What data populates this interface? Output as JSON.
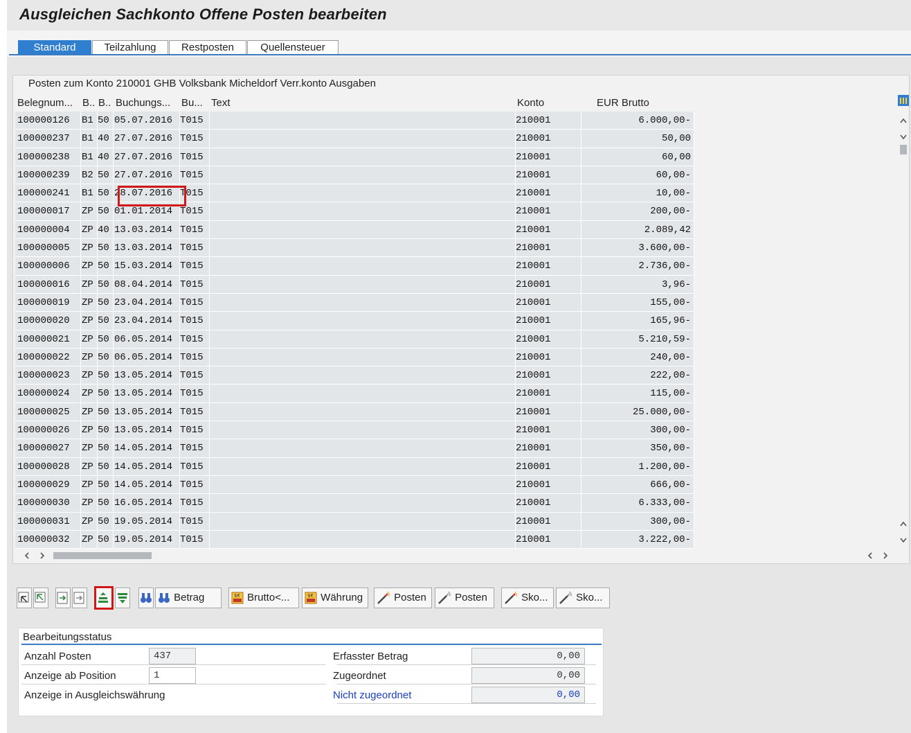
{
  "window": {
    "title": "Ausgleichen Sachkonto Offene Posten bearbeiten"
  },
  "tabs": [
    {
      "label": "Standard",
      "active": true
    },
    {
      "label": "Teilzahlung",
      "active": false
    },
    {
      "label": "Restposten",
      "active": false
    },
    {
      "label": "Quellensteuer",
      "active": false
    }
  ],
  "grid": {
    "title": "Posten zum Konto 210001 GHB Volksbank Micheldorf Verr.konto Ausgaben",
    "columns": [
      "Belegnum...",
      "B..",
      "B..",
      "Buchungs...",
      "Bu...",
      "Text",
      "Konto",
      "EUR Brutto"
    ],
    "rows": [
      [
        "100000126",
        "B1",
        "50",
        "05.07.2016",
        "T015",
        "",
        "210001",
        "6.000,00-"
      ],
      [
        "100000237",
        "B1",
        "40",
        "27.07.2016",
        "T015",
        "",
        "210001",
        "50,00"
      ],
      [
        "100000238",
        "B1",
        "40",
        "27.07.2016",
        "T015",
        "",
        "210001",
        "60,00"
      ],
      [
        "100000239",
        "B2",
        "50",
        "27.07.2016",
        "T015",
        "",
        "210001",
        "60,00-"
      ],
      [
        "100000241",
        "B1",
        "50",
        "28.07.2016",
        "T015",
        "",
        "210001",
        "10,00-"
      ],
      [
        "100000017",
        "ZP",
        "50",
        "01.01.2014",
        "T015",
        "",
        "210001",
        "200,00-"
      ],
      [
        "100000004",
        "ZP",
        "40",
        "13.03.2014",
        "T015",
        "",
        "210001",
        "2.089,42"
      ],
      [
        "100000005",
        "ZP",
        "50",
        "13.03.2014",
        "T015",
        "",
        "210001",
        "3.600,00-"
      ],
      [
        "100000006",
        "ZP",
        "50",
        "15.03.2014",
        "T015",
        "",
        "210001",
        "2.736,00-"
      ],
      [
        "100000016",
        "ZP",
        "50",
        "08.04.2014",
        "T015",
        "",
        "210001",
        "3,96-"
      ],
      [
        "100000019",
        "ZP",
        "50",
        "23.04.2014",
        "T015",
        "",
        "210001",
        "155,00-"
      ],
      [
        "100000020",
        "ZP",
        "50",
        "23.04.2014",
        "T015",
        "",
        "210001",
        "165,96-"
      ],
      [
        "100000021",
        "ZP",
        "50",
        "06.05.2014",
        "T015",
        "",
        "210001",
        "5.210,59-"
      ],
      [
        "100000022",
        "ZP",
        "50",
        "06.05.2014",
        "T015",
        "",
        "210001",
        "240,00-"
      ],
      [
        "100000023",
        "ZP",
        "50",
        "13.05.2014",
        "T015",
        "",
        "210001",
        "222,00-"
      ],
      [
        "100000024",
        "ZP",
        "50",
        "13.05.2014",
        "T015",
        "",
        "210001",
        "115,00-"
      ],
      [
        "100000025",
        "ZP",
        "50",
        "13.05.2014",
        "T015",
        "",
        "210001",
        "25.000,00-"
      ],
      [
        "100000026",
        "ZP",
        "50",
        "13.05.2014",
        "T015",
        "",
        "210001",
        "300,00-"
      ],
      [
        "100000027",
        "ZP",
        "50",
        "14.05.2014",
        "T015",
        "",
        "210001",
        "350,00-"
      ],
      [
        "100000028",
        "ZP",
        "50",
        "14.05.2014",
        "T015",
        "",
        "210001",
        "1.200,00-"
      ],
      [
        "100000029",
        "ZP",
        "50",
        "14.05.2014",
        "T015",
        "",
        "210001",
        "666,00-"
      ],
      [
        "100000030",
        "ZP",
        "50",
        "16.05.2014",
        "T015",
        "",
        "210001",
        "6.333,00-"
      ],
      [
        "100000031",
        "ZP",
        "50",
        "19.05.2014",
        "T015",
        "",
        "210001",
        "300,00-"
      ],
      [
        "100000032",
        "ZP",
        "50",
        "19.05.2014",
        "T015",
        "",
        "210001",
        "3.222,00-"
      ]
    ]
  },
  "toolbar": {
    "betrag": "Betrag",
    "brutto": "Brutto<...",
    "waehrung": "Währung",
    "posten1": "Posten",
    "posten2": "Posten",
    "sko1": "Sko...",
    "sko2": "Sko..."
  },
  "status": {
    "header": "Bearbeitungsstatus",
    "anzahl_label": "Anzahl Posten",
    "anzahl_value": "437",
    "anzeige_ab_label": "Anzeige ab Position",
    "anzeige_ab_value": "1",
    "ausgleichswaehrung_label": "Anzeige in Ausgleichswährung",
    "erfasster_label": "Erfasster Betrag",
    "erfasster_value": "0,00",
    "zugeordnet_label": "Zugeordnet",
    "zugeordnet_value": "0,00",
    "nicht_label": "Nicht zugeordnet",
    "nicht_value": "0,00"
  },
  "colors": {
    "accent": "#2f7ed0",
    "highlight": "#d01818",
    "link": "#1a3fc0"
  }
}
